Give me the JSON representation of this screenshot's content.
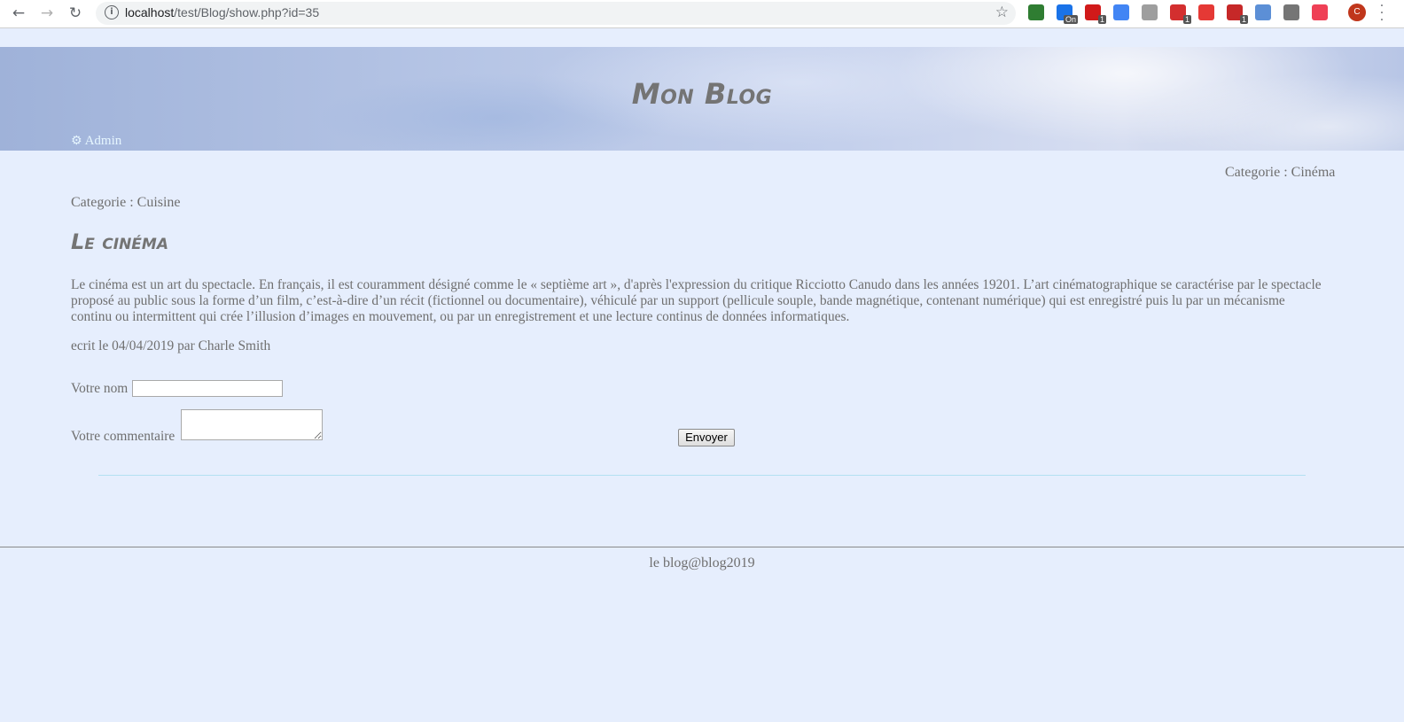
{
  "browser": {
    "url_host": "localhost",
    "url_path": "/test/Blog/show.php?id=35",
    "extensions": [
      {
        "name": "ms-tiles-extension",
        "color": "#2f7d32",
        "badge": ""
      },
      {
        "name": "translate-on-extension",
        "color": "#1a73e8",
        "badge": "On"
      },
      {
        "name": "opera-extension",
        "color": "#d11a1a",
        "badge": "1"
      },
      {
        "name": "google-translate-extension",
        "color": "#4285f4",
        "badge": ""
      },
      {
        "name": "globe-extension",
        "color": "#9e9e9e",
        "badge": ""
      },
      {
        "name": "adblock-shield-extension",
        "color": "#d32f2f",
        "badge": "1"
      },
      {
        "name": "red-circle-extension",
        "color": "#e53935",
        "badge": ""
      },
      {
        "name": "adblock-plus-extension",
        "color": "#c62828",
        "badge": "1"
      },
      {
        "name": "blue-swirl-extension",
        "color": "#5c8fd6",
        "badge": ""
      },
      {
        "name": "gear-extension",
        "color": "#757575",
        "badge": ""
      },
      {
        "name": "pocket-extension",
        "color": "#ef4056",
        "badge": ""
      }
    ],
    "avatar_letter": "C"
  },
  "header": {
    "title": "Mon Blog",
    "admin_icon": "gears-icon",
    "admin_label": "Admin"
  },
  "categories": {
    "right": "Categorie : Cinéma",
    "left": "Categorie : Cuisine"
  },
  "post": {
    "title": "Le cinéma",
    "body": "Le cinéma est un art du spectacle. En français, il est couramment désigné comme le « septième art », d'après l'expression du critique Ricciotto Canudo dans les années 19201. L’art cinématographique se caractérise par le spectacle proposé au public sous la forme d’un film, c’est-à-dire d’un récit (fictionnel ou documentaire), véhiculé par un support (pellicule souple, bande magnétique, contenant numérique) qui est enregistré puis lu par un mécanisme continu ou intermittent qui crée l’illusion d’images en mouvement, ou par un enregistrement et une lecture continus de données informatiques.",
    "byline": "ecrit le 04/04/2019 par Charle Smith"
  },
  "comment_form": {
    "name_label": "Votre nom",
    "name_value": "",
    "comment_label": "Votre commentaire",
    "comment_value": "",
    "submit_label": "Envoyer"
  },
  "footer": {
    "text": "le blog@blog2019"
  }
}
